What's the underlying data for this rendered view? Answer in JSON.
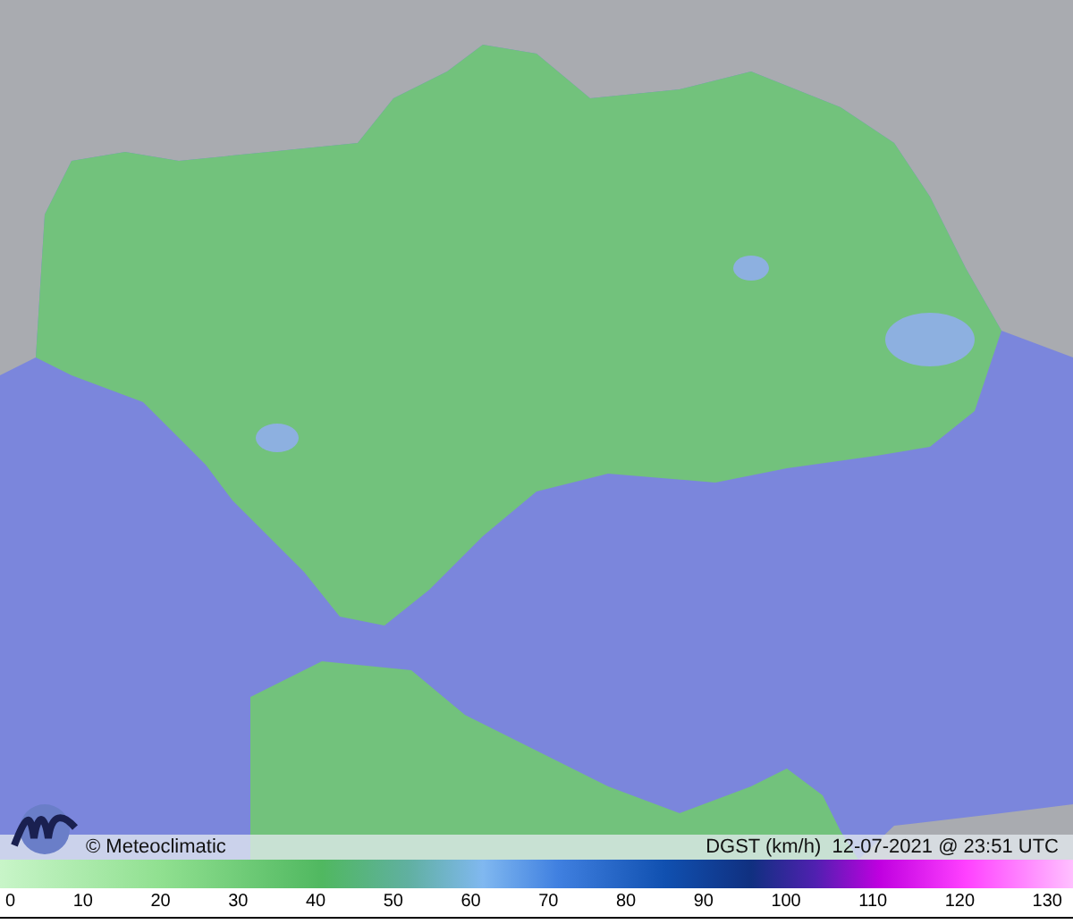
{
  "map": {
    "credit": "© Meteoclimatic",
    "caption": "DGST (km/h)  12-07-2021 @ 23:51 UTC"
  },
  "legend": {
    "ticks": [
      "0",
      "10",
      "20",
      "30",
      "40",
      "50",
      "60",
      "70",
      "80",
      "90",
      "100",
      "110",
      "120",
      "130"
    ]
  }
}
